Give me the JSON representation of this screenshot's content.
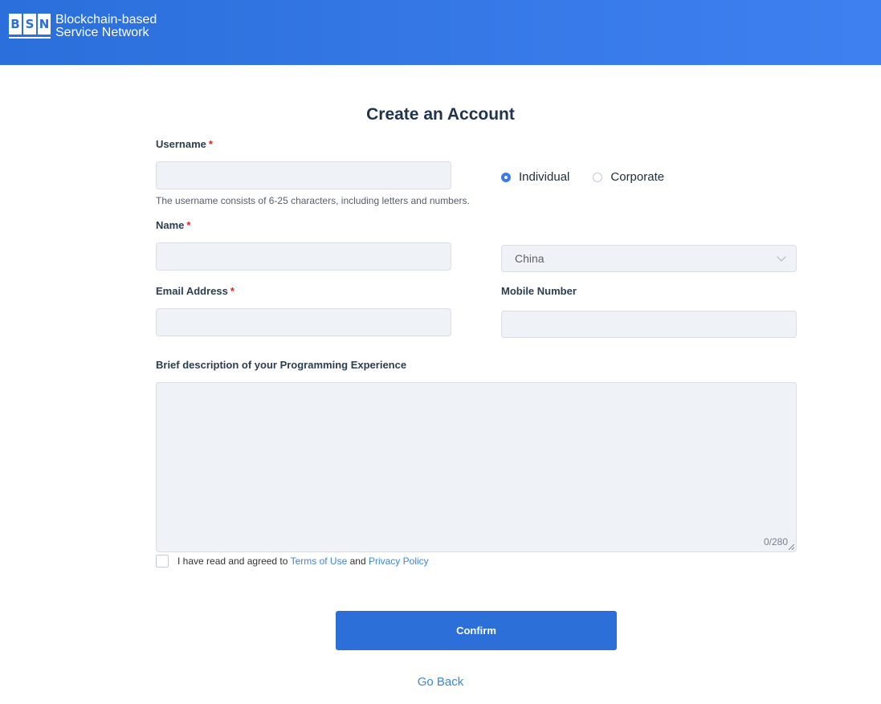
{
  "header": {
    "logo_letters": [
      "B",
      "S",
      "N"
    ],
    "brand_line1": "Blockchain-based",
    "brand_line2": "Service Network"
  },
  "form": {
    "title": "Create an Account",
    "required_mark": "*",
    "username": {
      "label": "Username",
      "value": "",
      "hint": "The username consists of 6-25 characters, including letters and numbers."
    },
    "account_type": {
      "options": [
        {
          "label": "Individual",
          "checked": true
        },
        {
          "label": "Corporate",
          "checked": false
        }
      ]
    },
    "name": {
      "label": "Name",
      "value": ""
    },
    "country": {
      "value": "China"
    },
    "email": {
      "label": "Email Address",
      "value": ""
    },
    "mobile": {
      "label": "Mobile Number",
      "value": ""
    },
    "experience": {
      "label": "Brief description of your Programming Experience",
      "value": "",
      "counter": "0/280"
    },
    "agreement": {
      "checked": false,
      "prefix": "I have read and agreed to",
      "terms_link": "Terms of Use",
      "conjunction": "and",
      "privacy_link": "Privacy Policy"
    },
    "confirm_label": "Confirm",
    "go_back_label": "Go Back"
  },
  "colors": {
    "header_start": "#2a6fdb",
    "header_end": "#3f80f0",
    "primary": "#2c6fd9",
    "link": "#3a86e0",
    "required": "#e02020"
  }
}
